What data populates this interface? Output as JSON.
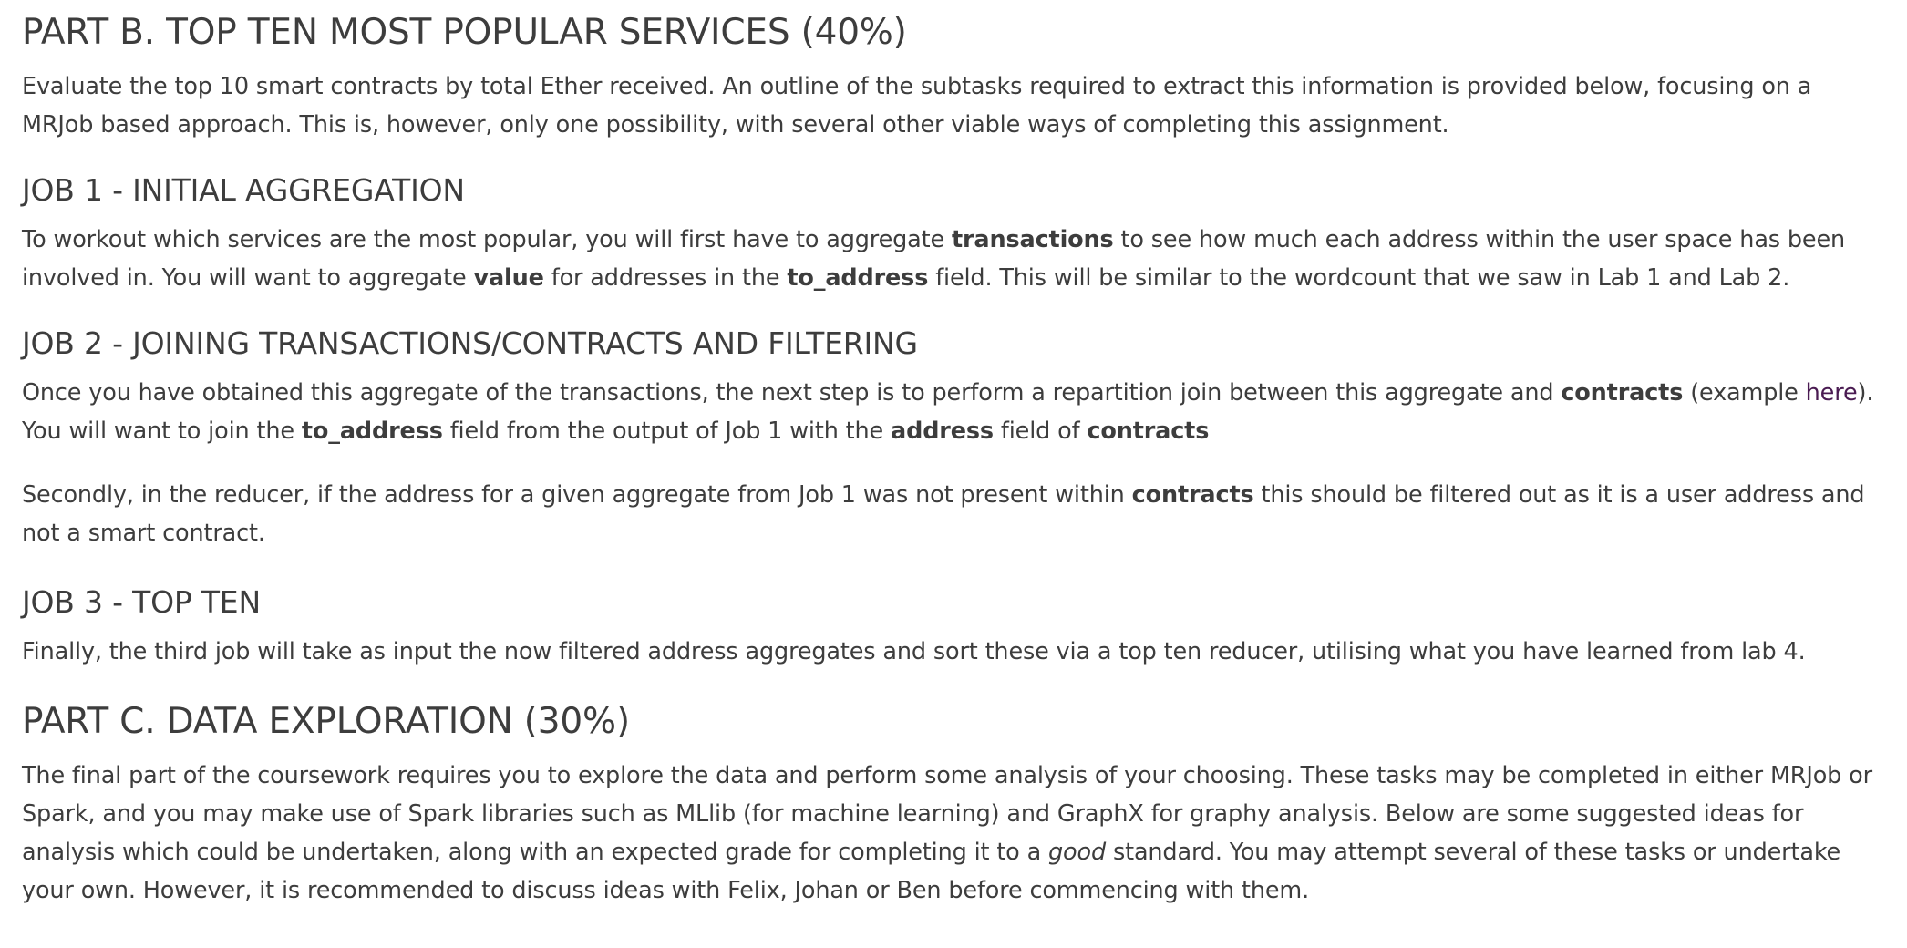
{
  "partB": {
    "heading": "PART B. TOP TEN MOST POPULAR SERVICES (40%)",
    "intro": "Evaluate the top 10 smart contracts by total Ether received. An outline of the subtasks required to extract this information is provided below, focusing on a MRJob based approach. This is, however, only one possibility, with several other viable ways of completing this assignment."
  },
  "job1": {
    "heading": "JOB 1 - INITIAL AGGREGATION",
    "t1": "To workout which services are the most popular, you will first have to aggregate ",
    "b1": "transactions",
    "t2": " to see how much each address within the user space has been involved in. You will want to aggregate ",
    "b2": "value",
    "t3": " for addresses in the ",
    "b3": "to_address",
    "t4": " field. This will be similar to the wordcount that we saw in Lab 1 and Lab 2."
  },
  "job2": {
    "heading": "JOB 2 - JOINING TRANSACTIONS/CONTRACTS AND FILTERING",
    "p1_t1": "Once you have obtained this aggregate of the transactions, the next step is to perform a repartition join between this aggregate and ",
    "p1_b1": "contracts",
    "p1_t2": " (example ",
    "p1_link": "here",
    "p1_t3": "). You will want to join the ",
    "p1_b2": "to_address",
    "p1_t4": " field from the output of Job 1 with the ",
    "p1_b3": "address",
    "p1_t5": " field of ",
    "p1_b4": "contracts",
    "p2_t1": "Secondly, in the reducer, if the address for a given aggregate from Job 1 was not present within ",
    "p2_b1": "contracts",
    "p2_t2": " this should be filtered out as it is a user address and not a smart contract."
  },
  "job3": {
    "heading": "JOB 3 - TOP TEN",
    "text": "Finally, the third job will take as input the now filtered address aggregates and sort these via a top ten reducer, utilising what you have learned from lab 4."
  },
  "partC": {
    "heading": "PART C. DATA EXPLORATION (30%)",
    "t1": "The final part of the coursework requires you to explore the data and perform some analysis of your choosing. These tasks may be completed in either MRJob or Spark, and you may make use of Spark libraries such as MLlib (for machine learning) and GraphX for graphy analysis. Below are some suggested ideas for analysis which could be undertaken, along with an expected grade for completing it to a ",
    "i1": "good",
    "t2": " standard. You may attempt several of these tasks or undertake your own. However, it is recommended to discuss ideas with Felix, Johan or Ben before commencing with them."
  }
}
